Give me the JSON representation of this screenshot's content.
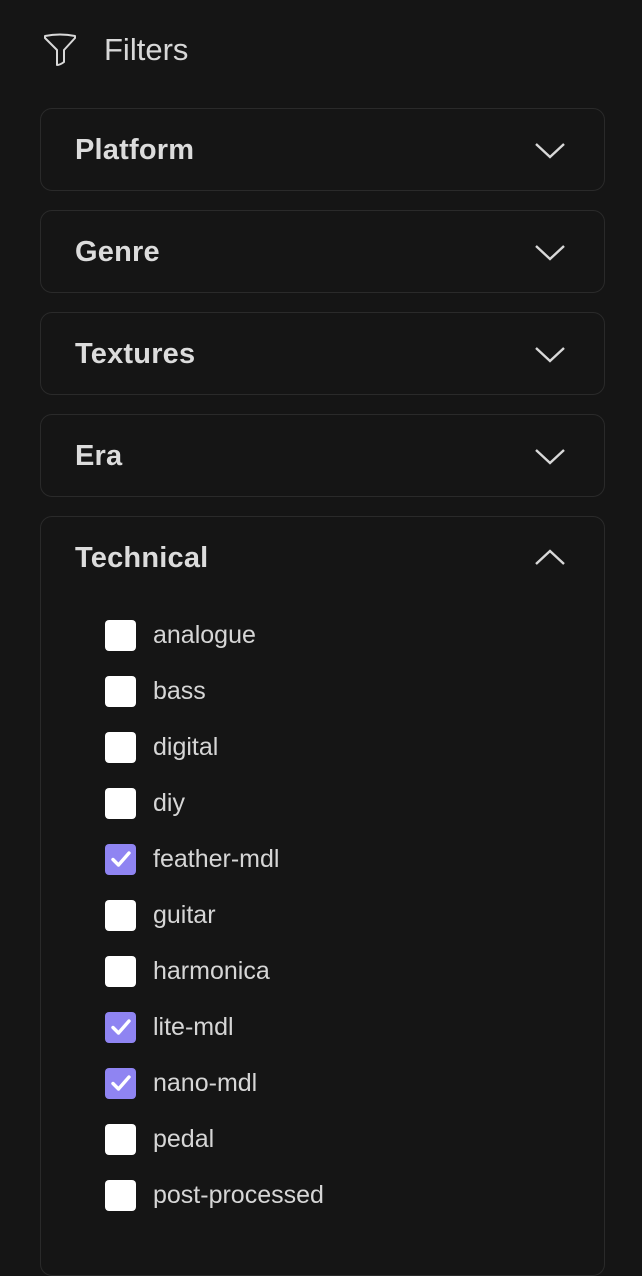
{
  "header": {
    "title": "Filters",
    "icon": "filter-icon"
  },
  "accent_color": "#8f84f2",
  "sections": [
    {
      "label": "Platform",
      "expanded": false
    },
    {
      "label": "Genre",
      "expanded": false
    },
    {
      "label": "Textures",
      "expanded": false
    },
    {
      "label": "Era",
      "expanded": false
    },
    {
      "label": "Technical",
      "expanded": true
    }
  ],
  "technical_options": [
    {
      "label": "analogue",
      "checked": false
    },
    {
      "label": "bass",
      "checked": false
    },
    {
      "label": "digital",
      "checked": false
    },
    {
      "label": "diy",
      "checked": false
    },
    {
      "label": "feather-mdl",
      "checked": true
    },
    {
      "label": "guitar",
      "checked": false
    },
    {
      "label": "harmonica",
      "checked": false
    },
    {
      "label": "lite-mdl",
      "checked": true
    },
    {
      "label": "nano-mdl",
      "checked": true
    },
    {
      "label": "pedal",
      "checked": false
    },
    {
      "label": "post-processed",
      "checked": false
    }
  ]
}
